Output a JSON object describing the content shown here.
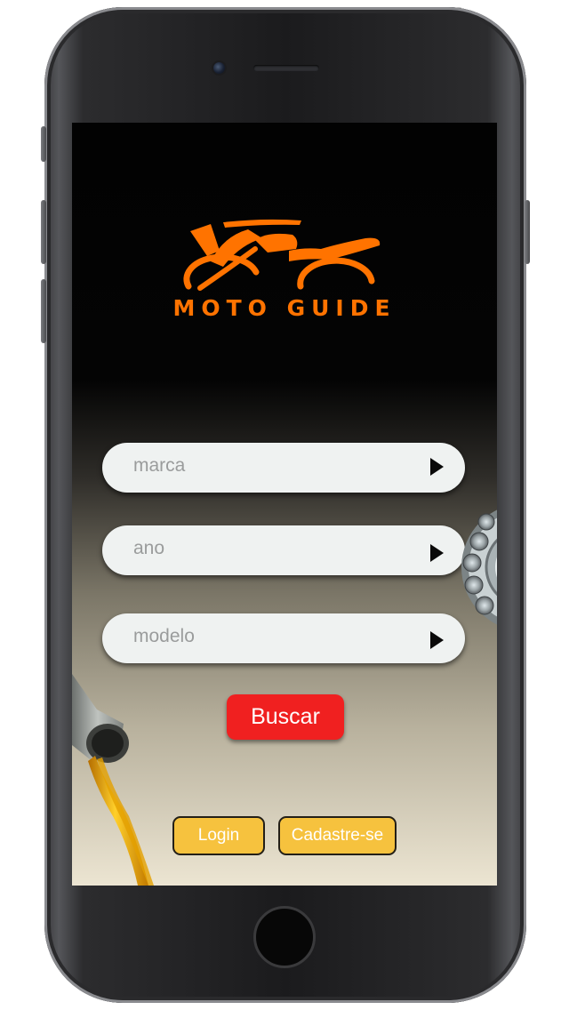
{
  "app": {
    "brand_name": "MOTO GUIDE",
    "accent_color": "#ff7300",
    "logo_icon": "motorcycle-icon"
  },
  "search_form": {
    "brand_field": {
      "placeholder": "marca",
      "icon": "play-arrow-icon"
    },
    "year_field": {
      "placeholder": "ano",
      "icon": "play-arrow-icon"
    },
    "model_field": {
      "placeholder": "modelo",
      "icon": "play-arrow-icon"
    },
    "search_button": {
      "label": "Buscar",
      "color": "#f02020"
    }
  },
  "auth": {
    "login_label": "Login",
    "signup_label": "Cadastre-se",
    "button_color": "#f6c23e"
  },
  "decorations": {
    "bearing": "ball-bearing-image",
    "oil": "oil-pouring-image"
  }
}
